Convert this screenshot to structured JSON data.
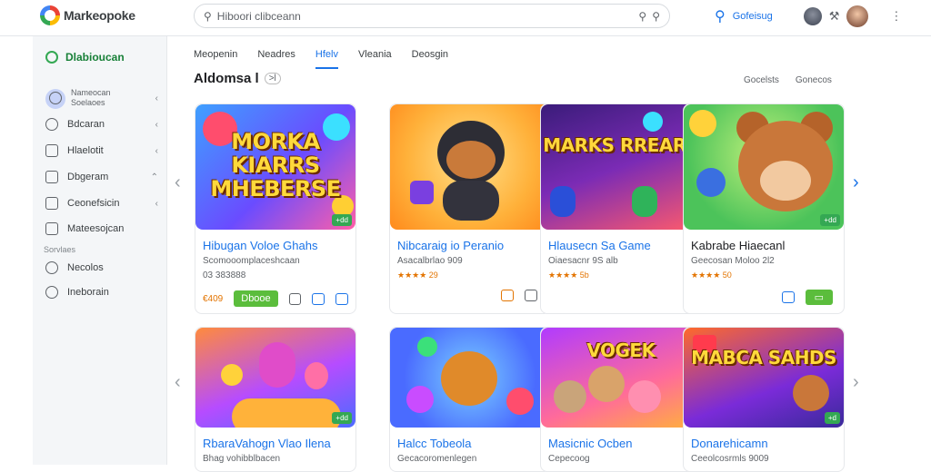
{
  "header": {
    "logo_text": "Markeopoke",
    "search_placeholder": "Hiboori clibceann",
    "search_icon_name": "search-icon",
    "settings_link": "Gofeisug"
  },
  "sidebar": {
    "home_label": "Dlabioucan",
    "items": [
      {
        "label": "Nameocan",
        "sub": "Soelaoes"
      },
      {
        "label": "Bdcaran"
      },
      {
        "label": "Hlaelotit"
      },
      {
        "label": "Dbgeram"
      },
      {
        "label": "Ceonefsicin"
      },
      {
        "label": "Mateesojcan"
      }
    ],
    "section_label": "Sorvlaes",
    "section_items": [
      {
        "label": "Necolos"
      },
      {
        "label": "Ineborain"
      }
    ]
  },
  "tabs": [
    {
      "label": "Meopenin"
    },
    {
      "label": "Neadres"
    },
    {
      "label": "Hfelv"
    },
    {
      "label": "Vleania"
    },
    {
      "label": "Deosgin"
    }
  ],
  "section": {
    "heading": "Aldomsa l",
    "heading_tag": ">l",
    "sort_a": "Gocelsts",
    "sort_b": "Gonecos"
  },
  "cards_row1": [
    {
      "art_text": "MORKA KIARRS MHEBERSE",
      "badge": "+dd",
      "title": "Hibugan Voloe Ghahs",
      "sub": "Scomooomplaceshcaan",
      "sub2": "03 383888",
      "price": "€409",
      "btn": "Dbooe"
    },
    {
      "art_text": "",
      "badge": "",
      "title": "Nibcaraig io Peranio",
      "sub": "Asacalbrlao 909",
      "rating": "★★★★ 29"
    },
    {
      "art_text": "MARKS RREARS",
      "badge": "",
      "title": "Hlausecn Sa Game",
      "sub": "Oiaesacnr 9S alb",
      "rating": "★★★★ 5b"
    },
    {
      "art_text": "",
      "badge": "+dd",
      "title": "Kabrabe Hiaecanl",
      "sub": "Geecosan Moloo 2l2",
      "rating": "★★★★ 50"
    }
  ],
  "cards_row2": [
    {
      "art_text": "",
      "badge": "+dd",
      "title": "RbaraVahogn Vlao Ilena",
      "sub": "Bhag vohibblbacen"
    },
    {
      "art_text": "",
      "badge": "",
      "title": "Halcc Tobeola",
      "sub": "Gecacoromenlegen"
    },
    {
      "art_text": "VOGEK",
      "badge": "",
      "title": "Masicnic Ocben",
      "sub": "Cepecoog"
    },
    {
      "art_text": "MABCA SAHDS",
      "badge": "+d",
      "title": "Donarehicamn",
      "sub": "Ceeolcosrmls 9009"
    }
  ]
}
